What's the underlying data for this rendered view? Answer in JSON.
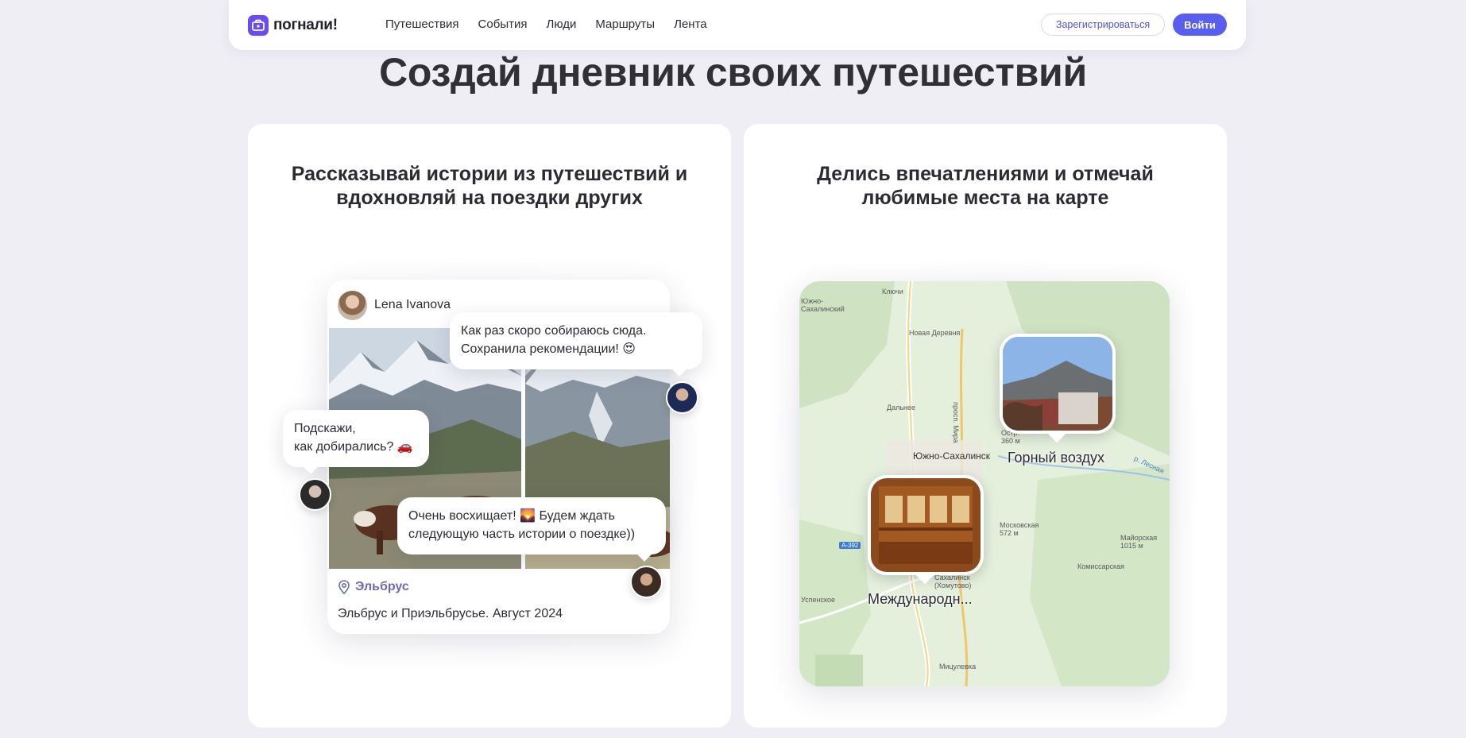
{
  "header": {
    "logo_text": "погнали!",
    "nav": [
      "Путешествия",
      "События",
      "Люди",
      "Маршруты",
      "Лента"
    ],
    "register_label": "Зарегистрироваться",
    "login_label": "Войти",
    "accent_color": "#5a5ef0"
  },
  "page": {
    "title": "Создай дневник своих путешествий"
  },
  "cards": [
    {
      "title": "Рассказывай истории из путешествий и вдохновляй на поездки других",
      "post": {
        "author": "Lena Ivanova",
        "location": "Эльбрус",
        "caption": "Эльбрус и Приэльбрусье. Август 2024"
      },
      "comments": [
        {
          "line1": "Как раз скоро собираюсь сюда.",
          "line2": "Сохранила рекомендации! 😍"
        },
        {
          "line1": "Подскажи,",
          "line2": "как добирались? 🚗"
        },
        {
          "line1": "Очень восхищает! 🌄 Будем ждать",
          "line2": "следующую часть истории о поездке))"
        }
      ]
    },
    {
      "title": "Делись впечатлениями и отмечай любимые места на карте",
      "map": {
        "places": [
          "Горный воздух",
          "Международн..."
        ],
        "labels": [
          "Ключи",
          "Южно-Сахалинский",
          "Новая Деревня",
          "Дальнее",
          "просп. Мира",
          "Южно-Сахалинск",
          "Остр. 360 м",
          "Московская 572 м",
          "Майорская 1015 м",
          "Комиссарская",
          "Успенское",
          "Сахалинск (Хомутово)",
          "Мицулевка",
          "А-392",
          "р. Лесная"
        ]
      }
    }
  ]
}
